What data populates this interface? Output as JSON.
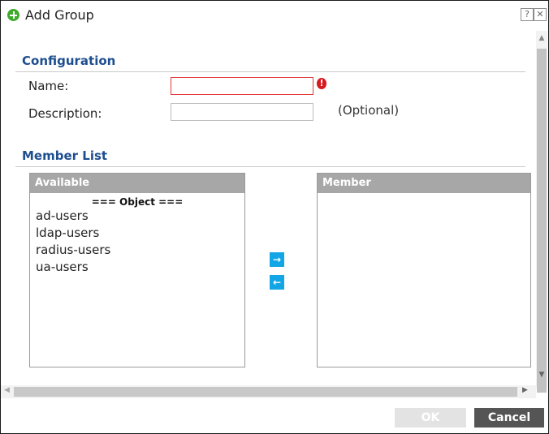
{
  "dialog": {
    "title": "Add Group",
    "help_label": "?",
    "close_label": "✕"
  },
  "configuration": {
    "heading": "Configuration",
    "name_label": "Name:",
    "name_value": "",
    "description_label": "Description:",
    "description_value": "",
    "error_glyph": "!",
    "optional_note": "(Optional)"
  },
  "member_list": {
    "heading": "Member List",
    "available": {
      "header": "Available",
      "group": "=== Object ===",
      "items": [
        "ad-users",
        "ldap-users",
        "radius-users",
        "ua-users"
      ]
    },
    "member": {
      "header": "Member",
      "items": []
    },
    "move_right_glyph": "→",
    "move_left_glyph": "←"
  },
  "scrollbars": {
    "up": "▲",
    "down": "▼",
    "left": "◀",
    "right": "▶"
  },
  "footer": {
    "ok_label": "OK",
    "cancel_label": "Cancel"
  },
  "colors": {
    "section_heading": "#1d4e8f",
    "error_border": "#e33b3b",
    "error_icon": "#d71920",
    "move_button": "#13a6e6",
    "cancel_button": "#555555",
    "add_icon": "#3faa2c"
  }
}
